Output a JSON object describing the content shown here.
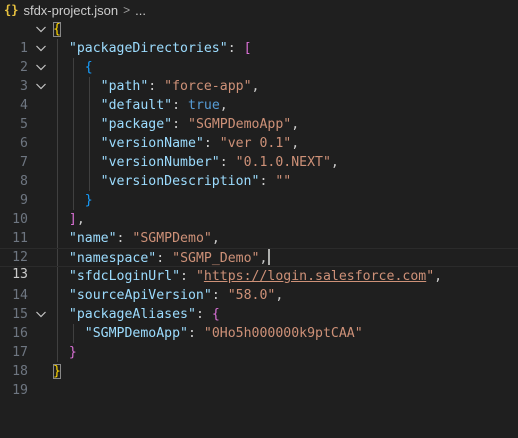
{
  "breadcrumb": {
    "icon": "json-braces-icon",
    "icon_glyph": "{}",
    "file": "sfdx-project.json",
    "separator": ">",
    "more": "..."
  },
  "editor": {
    "current_line": 13,
    "lines": [
      {
        "n": "1",
        "fold": true
      },
      {
        "n": "2",
        "fold": true
      },
      {
        "n": "3",
        "fold": true
      },
      {
        "n": "4",
        "fold": true
      },
      {
        "n": "5",
        "fold": false
      },
      {
        "n": "6",
        "fold": false
      },
      {
        "n": "7",
        "fold": false
      },
      {
        "n": "8",
        "fold": false
      },
      {
        "n": "9",
        "fold": false
      },
      {
        "n": "10",
        "fold": false
      },
      {
        "n": "11",
        "fold": false
      },
      {
        "n": "12",
        "fold": false
      },
      {
        "n": "13",
        "fold": false
      },
      {
        "n": "14",
        "fold": false
      },
      {
        "n": "15",
        "fold": false
      },
      {
        "n": "16",
        "fold": true
      },
      {
        "n": "17",
        "fold": false
      },
      {
        "n": "18",
        "fold": false
      },
      {
        "n": "19",
        "fold": false
      }
    ],
    "code": {
      "l1_open": "{",
      "l2_key": "\"packageDirectories\"",
      "l2_colon": ": ",
      "l2_open": "[",
      "l3_open": "{",
      "l4_key": "\"path\"",
      "l4_colon": ": ",
      "l4_val": "\"force-app\"",
      "l4_comma": ",",
      "l5_key": "\"default\"",
      "l5_colon": ": ",
      "l5_val": "true",
      "l5_comma": ",",
      "l6_key": "\"package\"",
      "l6_colon": ": ",
      "l6_val": "\"SGMPDemoApp\"",
      "l6_comma": ",",
      "l7_key": "\"versionName\"",
      "l7_colon": ": ",
      "l7_val": "\"ver 0.1\"",
      "l7_comma": ",",
      "l8_key": "\"versionNumber\"",
      "l8_colon": ": ",
      "l8_val": "\"0.1.0.NEXT\"",
      "l8_comma": ",",
      "l9_key": "\"versionDescription\"",
      "l9_colon": ": ",
      "l9_val": "\"\"",
      "l10_close": "}",
      "l11_close": "]",
      "l11_comma": ",",
      "l12_key": "\"name\"",
      "l12_colon": ": ",
      "l12_val": "\"SGMPDemo\"",
      "l12_comma": ",",
      "l13_key": "\"namespace\"",
      "l13_colon": ": ",
      "l13_val": "\"SGMP_Demo\"",
      "l13_comma": ",",
      "l14_key": "\"sfdcLoginUrl\"",
      "l14_colon": ": ",
      "l14_q1": "\"",
      "l14_url": "https://login.salesforce.com",
      "l14_q2": "\"",
      "l14_comma": ",",
      "l15_key": "\"sourceApiVersion\"",
      "l15_colon": ": ",
      "l15_val": "\"58.0\"",
      "l15_comma": ",",
      "l16_key": "\"packageAliases\"",
      "l16_colon": ": ",
      "l16_open": "{",
      "l17_key": "\"SGMPDemoApp\"",
      "l17_colon": ": ",
      "l17_val": "\"0Ho5h000000k9ptCAA\"",
      "l18_close": "}",
      "l19_close": "}"
    }
  },
  "colors": {
    "background": "#1f1f1f",
    "key": "#9cdcfe",
    "string": "#ce9178",
    "boolean": "#569cd6",
    "bracket_level1": "#ffd700",
    "bracket_level2": "#da70d6",
    "bracket_level3": "#179fff"
  }
}
